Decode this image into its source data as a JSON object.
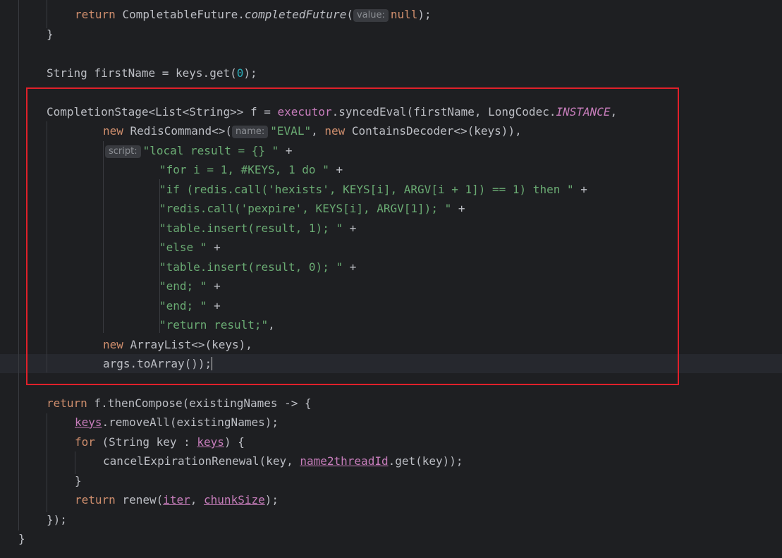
{
  "editor": {
    "language": "java",
    "highlight_color": "#e0202a",
    "lines": {
      "l1_ret": "return",
      "l1_obj": "CompletableFuture.",
      "l1_method": "completedFuture",
      "l1_open": "(",
      "l1_hint": "value:",
      "l1_null": "null",
      "l1_close": ");",
      "l2": "}",
      "l4_a": "String firstName = keys.get(",
      "l4_num": "0",
      "l4_b": ");",
      "l6_a": "CompletionStage<List<String>> f = ",
      "l6_executor": "executor",
      "l6_b": ".syncedEval(firstName, LongCodec.",
      "l6_const": "INSTANCE",
      "l6_c": ",",
      "l7_new": "new",
      "l7_a": " RedisCommand<>(",
      "l7_hint": "name:",
      "l7_str": "\"EVAL\"",
      "l7_b": ", ",
      "l7_new2": "new",
      "l7_c": " ContainsDecoder<>(keys)),",
      "l8_hint": "script:",
      "l8_str": "\"local result = {} \"",
      "l8_plus": " +",
      "l9_str": "\"for i = 1, #KEYS, 1 do \"",
      "l9_plus": " +",
      "l10_str": "\"if (redis.call('hexists', KEYS[i], ARGV[i + 1]) == 1) then \"",
      "l10_plus": " +",
      "l11_str": "\"redis.call('pexpire', KEYS[i], ARGV[1]); \"",
      "l11_plus": " +",
      "l12_str": "\"table.insert(result, 1); \"",
      "l12_plus": " +",
      "l13_str": "\"else \"",
      "l13_plus": " +",
      "l14_str": "\"table.insert(result, 0); \"",
      "l14_plus": " +",
      "l15_str": "\"end; \"",
      "l15_plus": " +",
      "l16_str": "\"end; \"",
      "l16_plus": " +",
      "l17_str": "\"return result;\"",
      "l17_b": ",",
      "l18_new": "new",
      "l18_a": " ArrayList<>(keys),",
      "l19_a": "args.toArray());",
      "l21_ret": "return",
      "l21_a": " f.thenCompose(existingNames -> {",
      "l22_keys": "keys",
      "l22_a": ".removeAll(existingNames);",
      "l23_for": "for",
      "l23_a": " (String key : ",
      "l23_keys": "keys",
      "l23_b": ") {",
      "l24_a": "cancelExpirationRenewal(key, ",
      "l24_field": "name2threadId",
      "l24_b": ".get(key));",
      "l25": "}",
      "l26_ret": "return",
      "l26_a": " renew(",
      "l26_iter": "iter",
      "l26_b": ", ",
      "l26_chunk": "chunkSize",
      "l26_c": ");",
      "l27": "});",
      "l28": "}"
    }
  }
}
